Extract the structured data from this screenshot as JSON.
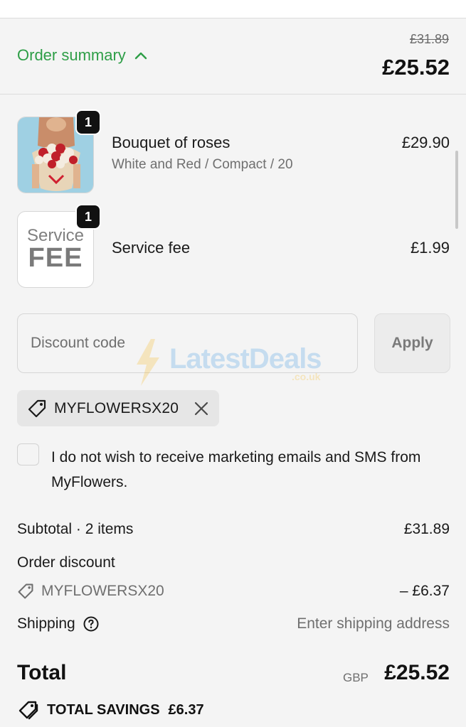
{
  "header": {
    "toggle_label": "Order summary",
    "original_price": "£31.89",
    "current_price": "£25.52"
  },
  "items": [
    {
      "quantity": "1",
      "name": "Bouquet of roses",
      "variant": "White and Red / Compact / 20",
      "price": "£29.90"
    },
    {
      "quantity": "1",
      "name": "Service fee",
      "price": "£1.99",
      "thumb_text_top": "Service",
      "thumb_text_big": "FEE"
    }
  ],
  "discount": {
    "placeholder": "Discount code",
    "apply_label": "Apply",
    "applied_code": "MYFLOWERSX20"
  },
  "watermark": {
    "main": "LatestDeals",
    "sub": ".co.uk"
  },
  "marketing_optout": {
    "label": "I do not wish to receive marketing emails and SMS from MyFlowers.",
    "checked": false
  },
  "totals": {
    "subtotal_label": "Subtotal · 2 items",
    "subtotal_value": "£31.89",
    "order_discount_label": "Order discount",
    "discount_code": "MYFLOWERSX20",
    "discount_value": "– £6.37",
    "shipping_label": "Shipping",
    "shipping_value": "Enter shipping address",
    "total_label": "Total",
    "currency": "GBP",
    "total_value": "£25.52",
    "savings_label": "TOTAL SAVINGS",
    "savings_value": "£6.37"
  },
  "colors": {
    "accent_green": "#2e9e47",
    "background": "#f4f4f4",
    "badge": "#111111"
  }
}
